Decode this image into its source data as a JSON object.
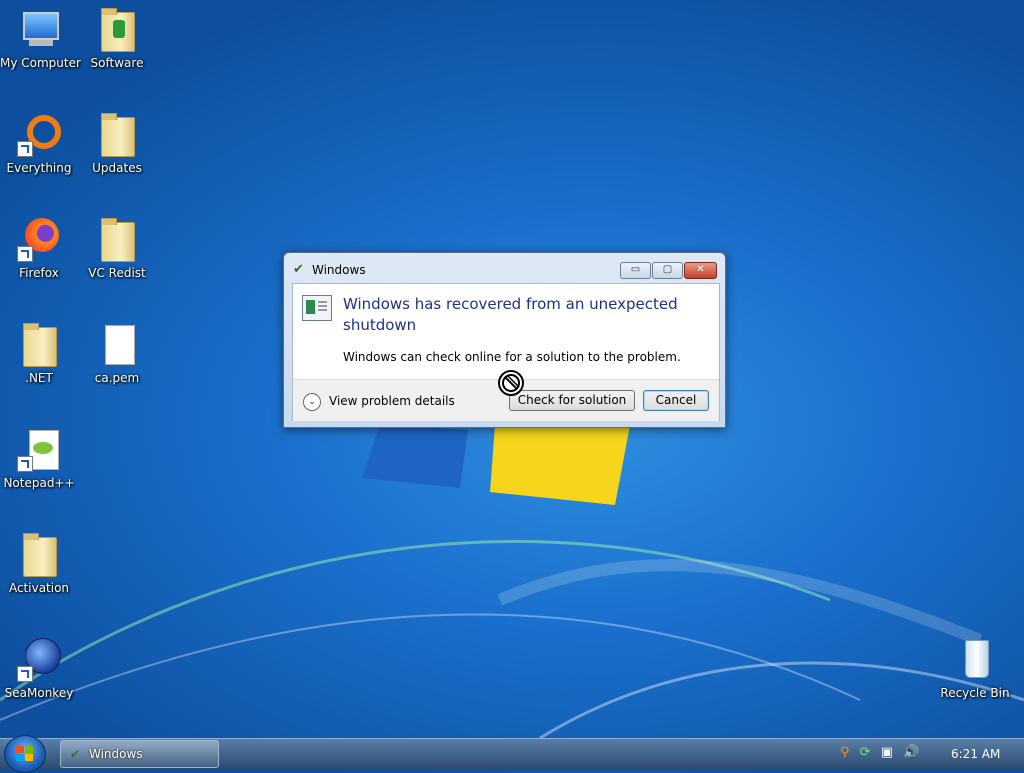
{
  "desktop": {
    "icons": [
      {
        "label": "My Computer"
      },
      {
        "label": "Software"
      },
      {
        "label": "Everything"
      },
      {
        "label": "Updates"
      },
      {
        "label": "Firefox"
      },
      {
        "label": "VC Redist"
      },
      {
        "label": ".NET"
      },
      {
        "label": "ca.pem"
      },
      {
        "label": "Notepad++"
      },
      {
        "label": "Activation"
      },
      {
        "label": "SeaMonkey"
      },
      {
        "label": "Recycle Bin"
      }
    ]
  },
  "dialog": {
    "title": "Windows",
    "min_glyph": "▭",
    "max_glyph": "▢",
    "close_glyph": "✕",
    "headline": "Windows has recovered from an unexpected shutdown",
    "message": "Windows can check online for a solution to the problem.",
    "details_chevron": "⌄",
    "details_label": "View problem details",
    "check_button": "Check for solution",
    "cancel_button": "Cancel"
  },
  "taskbar": {
    "window_button": "Windows",
    "tray": {
      "search": "⚲",
      "update": "⟳",
      "network": "▣",
      "volume": "🔊"
    },
    "clock": "6:21 AM"
  },
  "colors": {
    "accent": "#1e3287",
    "desktop": "#1a6fcc"
  }
}
